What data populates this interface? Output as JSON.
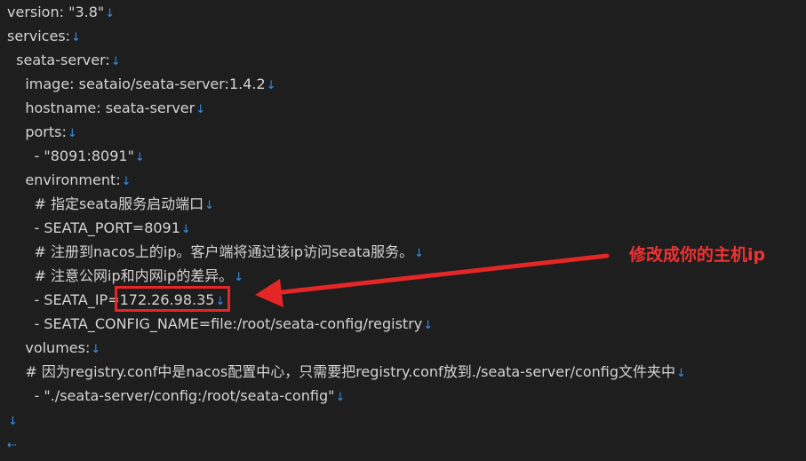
{
  "editor": {
    "lines": [
      {
        "text": "version: \"3.8\""
      },
      {
        "text": "services:"
      },
      {
        "text": "  seata-server:"
      },
      {
        "text": "    image: seataio/seata-server:1.4.2"
      },
      {
        "text": "    hostname: seata-server"
      },
      {
        "text": "    ports:"
      },
      {
        "text": "      - \"8091:8091\""
      },
      {
        "text": "    environment:"
      },
      {
        "text": "      # 指定seata服务启动端口"
      },
      {
        "text": "      - SEATA_PORT=8091"
      },
      {
        "text": "      # 注册到nacos上的ip。客户端将通过该ip访问seata服务。"
      },
      {
        "text": "      # 注意公网ip和内网ip的差异。"
      },
      {
        "text": "      - SEATA_IP=172.26.98.35"
      },
      {
        "text": "      - SEATA_CONFIG_NAME=file:/root/seata-config/registry"
      },
      {
        "text": "    volumes:"
      },
      {
        "text": "    # 因为registry.conf中是nacos配置中心，只需要把registry.conf放到./seata-server/config文件夹中"
      },
      {
        "text": "      - \"./seata-server/config:/root/seata-config\""
      },
      {
        "text": ""
      }
    ],
    "newline_symbol": "↓",
    "eof_symbol": "⇠"
  },
  "annotation": {
    "text": "修改成你的主机ip",
    "color": "#f03232"
  },
  "colors": {
    "background": "#1e1e1e",
    "text": "#d4d4d4",
    "newline_marker": "#3a8ee6",
    "highlight": "#e52626"
  }
}
